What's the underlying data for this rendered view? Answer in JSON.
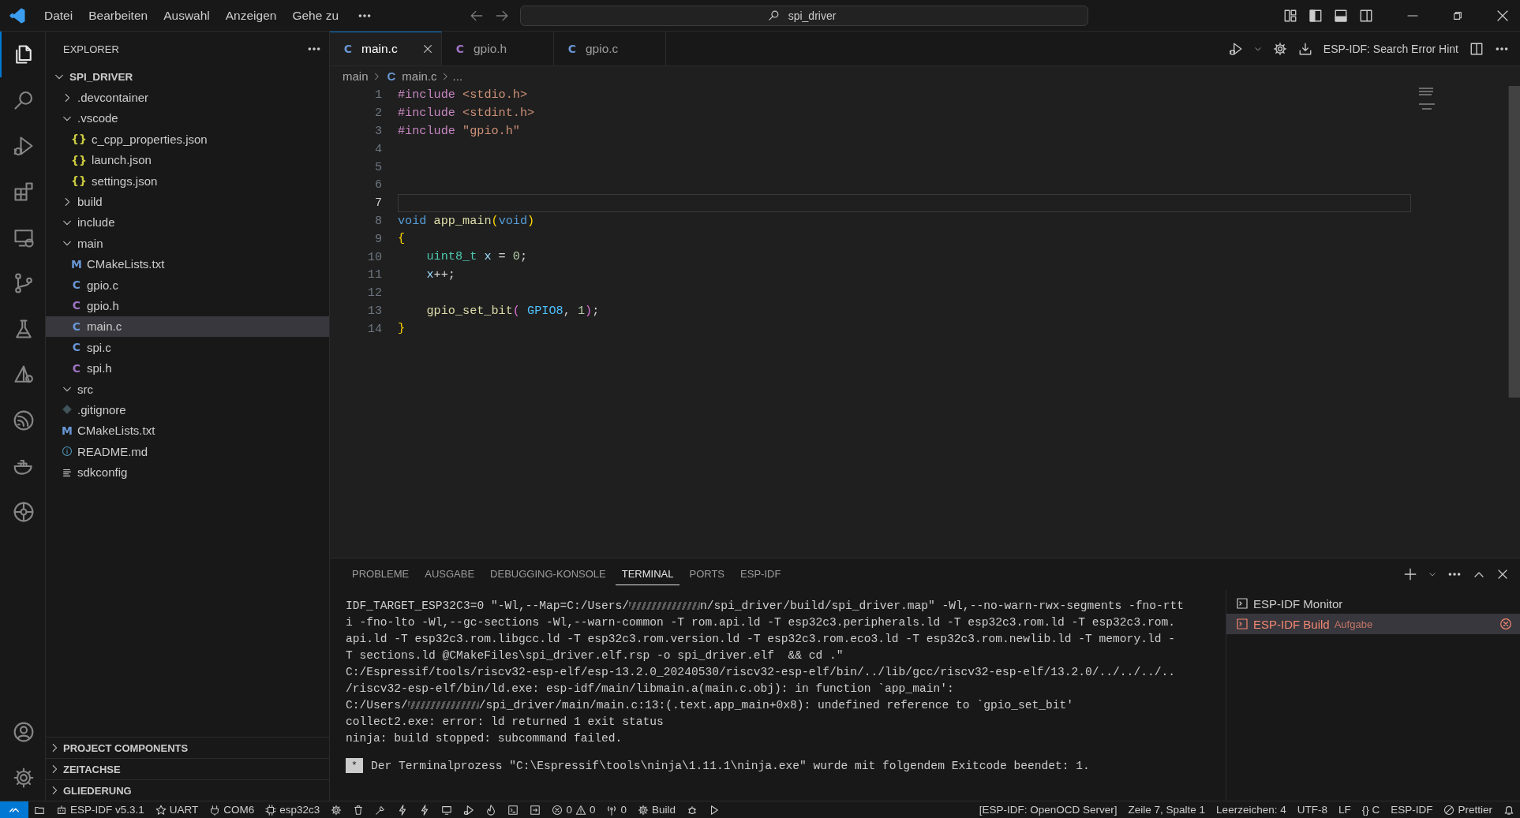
{
  "menu": [
    "Datei",
    "Bearbeiten",
    "Auswahl",
    "Anzeigen",
    "Gehe zu"
  ],
  "search": {
    "value": "spi_driver"
  },
  "activity_bar": {
    "items": [
      {
        "selected": true
      },
      {
        "selected": false
      },
      {
        "selected": false
      },
      {
        "selected": false
      },
      {
        "selected": false
      },
      {
        "selected": false
      },
      {
        "selected": false
      },
      {
        "selected": false
      },
      {
        "selected": false
      },
      {
        "selected": false
      },
      {
        "selected": false
      }
    ]
  },
  "sidebar": {
    "title": "EXPLORER",
    "root": {
      "label": "SPI_DRIVER",
      "expanded": true
    },
    "tree": [
      {
        "label": ".devcontainer",
        "kind": "folder",
        "expanded": false,
        "selected": false
      },
      {
        "label": ".vscode",
        "kind": "folder",
        "expanded": true,
        "selected": false,
        "children": [
          {
            "label": "c_cpp_properties.json",
            "kind": "json",
            "icon": "{}",
            "selected": false
          },
          {
            "label": "launch.json",
            "kind": "json",
            "icon": "{}",
            "selected": false
          },
          {
            "label": "settings.json",
            "kind": "json",
            "icon": "{}",
            "selected": false
          }
        ]
      },
      {
        "label": "build",
        "kind": "folder",
        "expanded": false,
        "selected": false
      },
      {
        "label": "include",
        "kind": "folder",
        "expanded": true,
        "selected": false
      },
      {
        "label": "main",
        "kind": "folder",
        "expanded": true,
        "selected": false,
        "children": [
          {
            "label": "CMakeLists.txt",
            "kind": "cmake",
            "icon": "M",
            "selected": false
          },
          {
            "label": "gpio.c",
            "kind": "c",
            "icon": "C",
            "selected": false
          },
          {
            "label": "gpio.h",
            "kind": "h",
            "icon": "C",
            "selected": false
          },
          {
            "label": "main.c",
            "kind": "c",
            "icon": "C",
            "selected": true
          },
          {
            "label": "spi.c",
            "kind": "c",
            "icon": "C",
            "selected": false
          },
          {
            "label": "spi.h",
            "kind": "h",
            "icon": "C",
            "selected": false
          }
        ]
      },
      {
        "label": "src",
        "kind": "folder",
        "expanded": true,
        "selected": false
      },
      {
        "label": ".gitignore",
        "kind": "git",
        "selected": false
      },
      {
        "label": "CMakeLists.txt",
        "kind": "cmake",
        "icon": "M",
        "selected": false
      },
      {
        "label": "README.md",
        "kind": "info",
        "selected": false
      },
      {
        "label": "sdkconfig",
        "kind": "config",
        "selected": false
      }
    ],
    "sections": [
      {
        "label": "PROJECT COMPONENTS",
        "expanded": false
      },
      {
        "label": "ZEITACHSE",
        "expanded": false
      },
      {
        "label": "GLIEDERUNG",
        "expanded": false
      }
    ]
  },
  "tabs": [
    {
      "label": "main.c",
      "kind": "c",
      "icon": "C",
      "selected": true
    },
    {
      "label": "gpio.h",
      "kind": "h",
      "icon": "C",
      "selected": false
    },
    {
      "label": "gpio.c",
      "kind": "c",
      "icon": "C",
      "selected": false
    }
  ],
  "editor_toolbar": {
    "hint_button": "ESP-IDF: Search Error Hint"
  },
  "breadcrumb": [
    {
      "label": "main"
    },
    {
      "label": "main.c",
      "icon": "C"
    },
    {
      "label": "..."
    }
  ],
  "code": {
    "lines": [
      {
        "n": "1",
        "current": false,
        "tokens": [
          {
            "t": "#include",
            "kind": "directive"
          },
          {
            "t": " <stdio.h>",
            "kind": "string"
          }
        ]
      },
      {
        "n": "2",
        "current": false,
        "tokens": [
          {
            "t": "#include",
            "kind": "directive"
          },
          {
            "t": " <stdint.h>",
            "kind": "string"
          }
        ]
      },
      {
        "n": "3",
        "current": false,
        "tokens": [
          {
            "t": "#include",
            "kind": "directive"
          },
          {
            "t": " \"gpio.h\"",
            "kind": "string"
          }
        ]
      },
      {
        "n": "4",
        "current": false
      },
      {
        "n": "5",
        "current": false
      },
      {
        "n": "6",
        "current": false
      },
      {
        "n": "7",
        "current": true
      },
      {
        "n": "8",
        "current": false,
        "tokens": [
          {
            "t": "void",
            "kind": "keyword"
          },
          {
            "t": " app_main",
            "kind": "func"
          },
          {
            "t": "(",
            "kind": "bracket1"
          },
          {
            "t": "void",
            "kind": "keyword"
          },
          {
            "t": ")",
            "kind": "bracket1"
          }
        ]
      },
      {
        "n": "9",
        "current": false,
        "tokens": [
          {
            "t": "{",
            "kind": "bracket1"
          }
        ]
      },
      {
        "n": "10",
        "current": false,
        "tokens": [
          {
            "t": "    uint8_t",
            "kind": "type"
          },
          {
            "t": " x",
            "kind": "var"
          },
          {
            "t": " = ",
            "kind": "plain"
          },
          {
            "t": "0",
            "kind": "num"
          },
          {
            "t": ";",
            "kind": "plain"
          }
        ]
      },
      {
        "n": "11",
        "current": false,
        "tokens": [
          {
            "t": "    x",
            "kind": "var"
          },
          {
            "t": "++;",
            "kind": "plain"
          }
        ]
      },
      {
        "n": "12",
        "current": false
      },
      {
        "n": "13",
        "current": false,
        "tokens": [
          {
            "t": "    gpio_set_bit",
            "kind": "func"
          },
          {
            "t": "(",
            "kind": "bracket2"
          },
          {
            "t": " GPIO8",
            "kind": "const"
          },
          {
            "t": ", ",
            "kind": "plain"
          },
          {
            "t": "1",
            "kind": "num"
          },
          {
            "t": ")",
            "kind": "bracket2"
          },
          {
            "t": ";",
            "kind": "plain"
          }
        ]
      },
      {
        "n": "14",
        "current": false,
        "tokens": [
          {
            "t": "}",
            "kind": "bracket1"
          }
        ]
      }
    ]
  },
  "panel": {
    "tabs": [
      {
        "label": "PROBLEME",
        "selected": false
      },
      {
        "label": "AUSGABE",
        "selected": false
      },
      {
        "label": "DEBUGGING-KONSOLE",
        "selected": false
      },
      {
        "label": "TERMINAL",
        "selected": true
      },
      {
        "label": "PORTS",
        "selected": false
      },
      {
        "label": "ESP-IDF",
        "selected": false
      }
    ],
    "terminal_lines": [
      [
        {
          "kind": "text",
          "text": "IDF_TARGET_ESP32C3=0 \"-Wl,--Map=C:/Users/"
        },
        {
          "kind": "redaction"
        },
        {
          "kind": "text",
          "text": "n/spi_driver/build/spi_driver.map\" -Wl,--no-warn-rwx-segments -fno-rtt"
        }
      ],
      [
        {
          "kind": "text",
          "text": "i -fno-lto -Wl,--gc-sections -Wl,--warn-common -T rom.api.ld -T esp32c3.peripherals.ld -T esp32c3.rom.ld -T esp32c3.rom."
        }
      ],
      [
        {
          "kind": "text",
          "text": "api.ld -T esp32c3.rom.libgcc.ld -T esp32c3.rom.version.ld -T esp32c3.rom.eco3.ld -T esp32c3.rom.newlib.ld -T memory.ld -"
        }
      ],
      [
        {
          "kind": "text",
          "text": "T sections.ld @CMakeFiles\\spi_driver.elf.rsp -o spi_driver.elf  && cd .\""
        }
      ],
      [
        {
          "kind": "text",
          "text": "C:/Espressif/tools/riscv32-esp-elf/esp-13.2.0_20240530/riscv32-esp-elf/bin/../lib/gcc/riscv32-esp-elf/13.2.0/../../../.."
        }
      ],
      [
        {
          "kind": "text",
          "text": "/riscv32-esp-elf/bin/ld.exe: esp-idf/main/libmain.a(main.c.obj): in function `app_main':"
        }
      ],
      [
        {
          "kind": "text",
          "text": "C:/Users/"
        },
        {
          "kind": "redaction"
        },
        {
          "kind": "text",
          "text": "/spi_driver/main/main.c:13:(.text.app_main+0x8): undefined reference to `gpio_set_bit'"
        }
      ],
      [
        {
          "kind": "text",
          "text": "collect2.exe: error: ld returned 1 exit status"
        }
      ],
      [
        {
          "kind": "text",
          "text": "ninja: build stopped: subcommand failed."
        }
      ]
    ],
    "exit_badge": "*",
    "exit_message": "Der Terminalprozess \"C:\\Espressif\\tools\\ninja\\1.11.1\\ninja.exe\" wurde mit folgendem Exitcode beendet: 1.",
    "terminals": [
      {
        "label": "ESP-IDF Monitor",
        "selected": false,
        "error": false
      },
      {
        "label": "ESP-IDF Build",
        "detail": "Aufgabe",
        "selected": true,
        "error": true
      }
    ]
  },
  "status_bar": {
    "board_items": [
      "ESP-IDF v5.3.1",
      "UART",
      "COM6",
      "esp32c3"
    ],
    "errors": "0",
    "warnings": "0",
    "ports": "0",
    "build": "Build",
    "right": [
      "[ESP-IDF: OpenOCD Server]",
      "Zeile 7, Spalte 1",
      "Leerzeichen: 4",
      "UTF-8",
      "LF",
      "{} C",
      "ESP-IDF"
    ],
    "prettier": "Prettier"
  }
}
